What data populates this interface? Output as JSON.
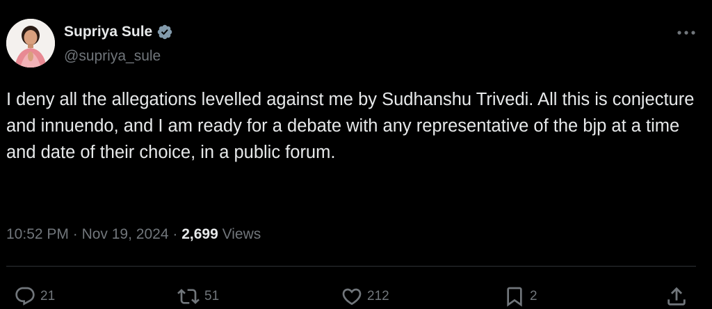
{
  "author": {
    "display_name": "Supriya Sule",
    "handle": "@supriya_sule",
    "verified": true,
    "verified_color": "#829aab"
  },
  "tweet": {
    "text": "I deny all the allegations levelled against me by Sudhanshu Trivedi. All this is conjecture and innuendo, and I am ready for a debate with any representative of the bjp at a time and date of their choice, in a public forum.",
    "time": "10:52 PM",
    "separator": "·",
    "date": "Nov 19, 2024",
    "views_count": "2,699",
    "views_label": "Views"
  },
  "actions": {
    "replies": "21",
    "reposts": "51",
    "likes": "212",
    "bookmarks": "2"
  },
  "colors": {
    "background": "#000000",
    "primary_text": "#e7e9ea",
    "secondary_text": "#71767b",
    "divider": "#2f3336"
  },
  "icons": [
    "reply-icon",
    "repost-icon",
    "like-icon",
    "bookmark-icon",
    "share-icon",
    "more-icon",
    "verified-badge-icon"
  ]
}
